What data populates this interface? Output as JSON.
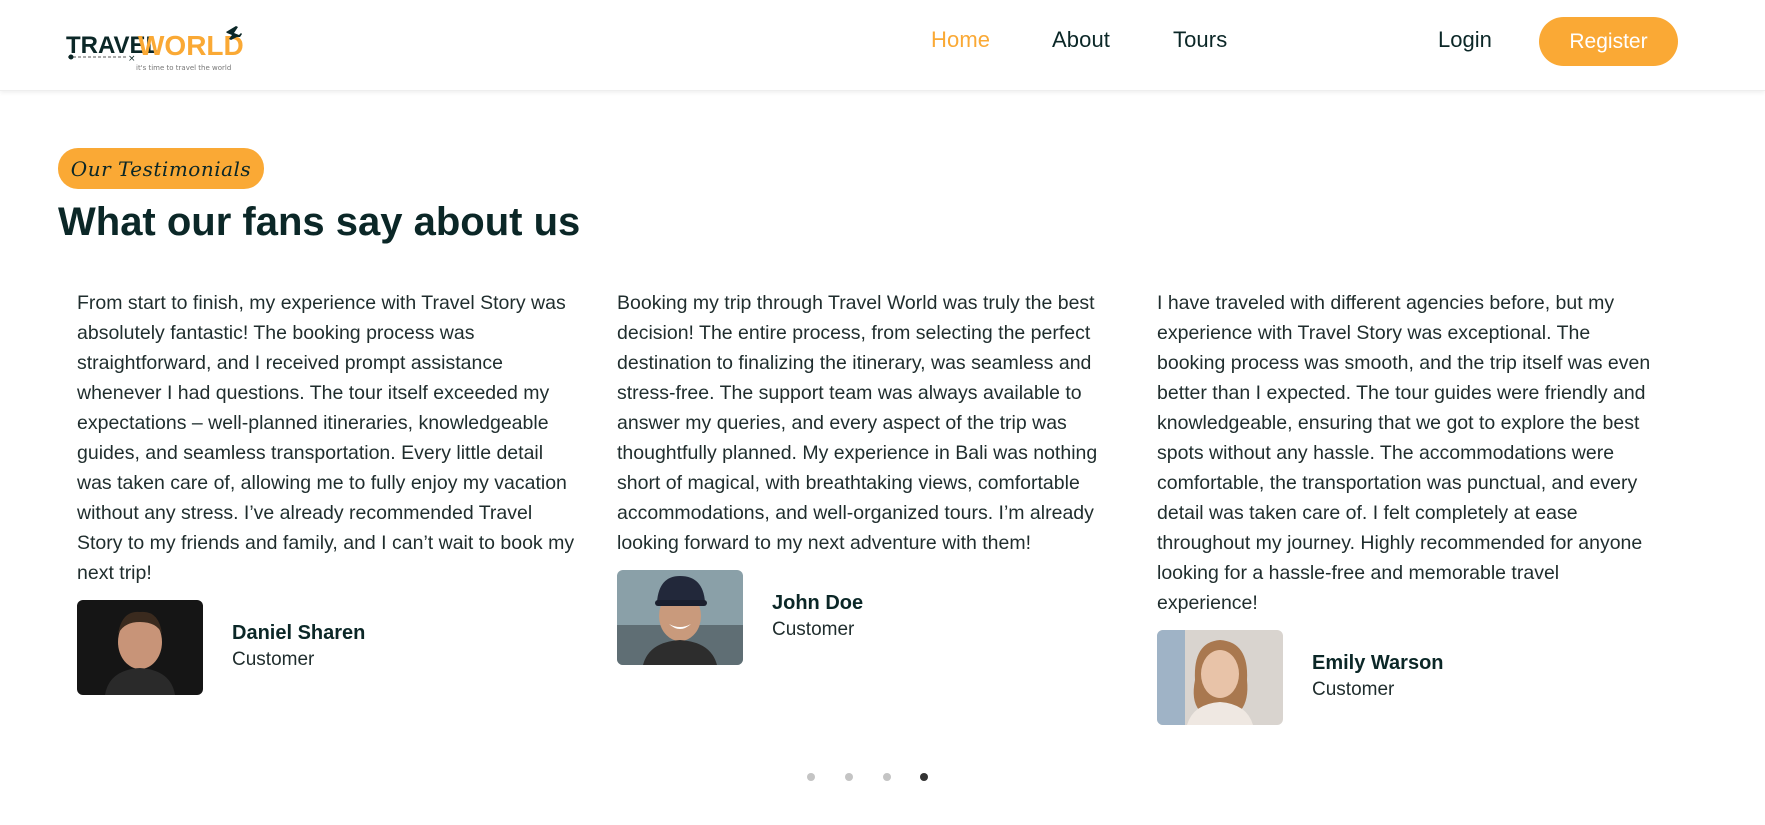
{
  "header": {
    "logo": {
      "brand_part1": "TRAVEL",
      "brand_part2": "WORLD",
      "tagline": "it's time to travel the world"
    },
    "nav": [
      {
        "label": "Home",
        "active": true
      },
      {
        "label": "About",
        "active": false
      },
      {
        "label": "Tours",
        "active": false
      }
    ],
    "login_label": "Login",
    "register_label": "Register"
  },
  "section": {
    "subtitle": "Our Testimonials",
    "title": "What our fans say about us"
  },
  "testimonials": [
    {
      "text": "From start to finish, my experience with Travel Story was absolutely fantastic! The booking process was straightforward, and I received prompt assistance whenever I had questions. The tour itself exceeded my expectations – well-planned itineraries, knowledgeable guides, and seamless transportation. Every little detail was taken care of, allowing me to fully enjoy my vacation without any stress. I’ve already recommended Travel Story to my friends and family, and I can’t wait to book my next trip!",
      "name": "Daniel Sharen",
      "role": "Customer"
    },
    {
      "text": "Booking my trip through Travel World was truly the best decision! The entire process, from selecting the perfect destination to finalizing the itinerary, was seamless and stress-free. The support team was always available to answer my queries, and every aspect of the trip was thoughtfully planned. My experience in Bali was nothing short of magical, with breathtaking views, comfortable accommodations, and well-organized tours. I’m already looking forward to my next adventure with them!",
      "name": "John Doe",
      "role": "Customer"
    },
    {
      "text": "I have traveled with different agencies before, but my experience with Travel Story was exceptional. The booking process was smooth, and the trip itself was even better than I expected. The tour guides were friendly and knowledgeable, ensuring that we got to explore the best spots without any hassle. The accommodations were comfortable, the transportation was punctual, and every detail was taken care of. I felt completely at ease throughout my journey. Highly recommended for anyone looking for a hassle-free and memorable travel experience!",
      "name": "Emily Warson",
      "role": "Customer"
    }
  ],
  "carousel": {
    "total_dots": 4,
    "active_index": 3
  },
  "colors": {
    "accent": "#faa935",
    "heading": "#0b2727",
    "text": "#1f2d2d"
  }
}
